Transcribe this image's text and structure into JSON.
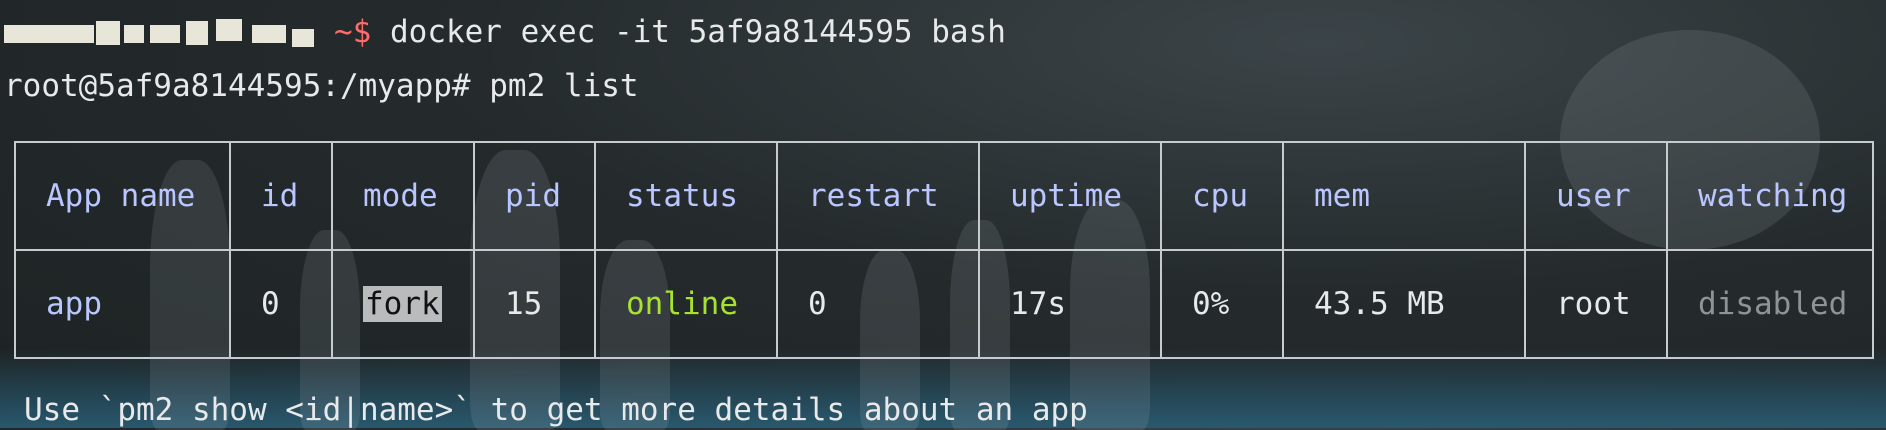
{
  "terminal": {
    "line1": {
      "prompt_suffix": "~$",
      "command": " docker exec -it 5af9a8144595 bash"
    },
    "line2": {
      "prompt": "root@5af9a8144595:/myapp#",
      "command": " pm2 list"
    }
  },
  "table": {
    "headers": [
      "App name",
      "id",
      "mode",
      "pid",
      "status",
      "restart",
      "uptime",
      "cpu",
      "mem",
      "user",
      "watching"
    ],
    "row": {
      "app_name": "app",
      "id": "0",
      "mode": "fork",
      "pid": "15",
      "status": "online",
      "restart": "0",
      "uptime": "17s",
      "cpu": "0%",
      "mem": "43.5 MB",
      "user": "root",
      "watching": "disabled"
    }
  },
  "footer": {
    "text": "Use `pm2 show <id|name>` to get more details about an app"
  },
  "colors": {
    "background": "#252b2d",
    "header_text": "#b9c6ff",
    "online": "#a6e22e",
    "disabled": "#8d9496",
    "prompt_tilde": "#ff6b6b"
  }
}
